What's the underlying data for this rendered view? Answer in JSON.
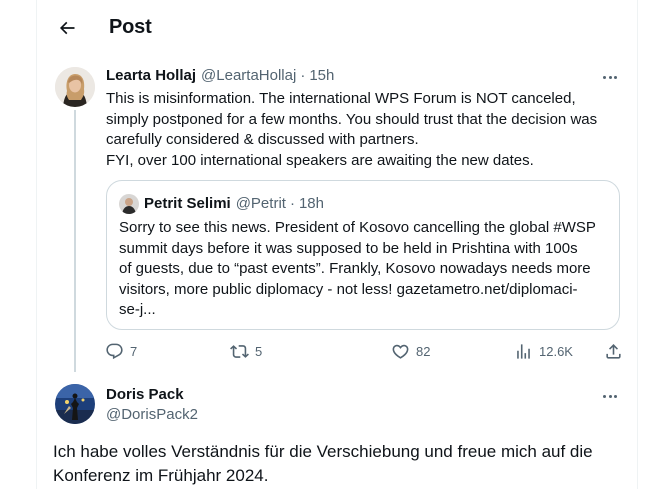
{
  "header": {
    "title": "Post"
  },
  "main_tweet": {
    "author_name": "Learta Hollaj",
    "handle": "@LeartaHollaj",
    "separator": "·",
    "time": "15h",
    "text_lines": [
      "This is misinformation. The international WPS Forum is NOT canceled,",
      "simply postponed for a few months. You should trust that the decision was",
      "carefully considered & discussed with partners.",
      "FYI, over 100 international speakers are awaiting the new dates."
    ],
    "quote": {
      "author_name": "Petrit Selimi",
      "handle": "@Petrit",
      "separator": "·",
      "time": "18h",
      "text_lines": [
        "Sorry to see this news. President of Kosovo cancelling the global #WSP",
        "summit days before it was supposed to be held in Prishtina with 100s",
        "of guests, due to “past events”. Frankly, Kosovo nowadays needs more",
        "visitors, more public diplomacy - not less! gazetametro.net/diplomaci-",
        "se-j..."
      ]
    },
    "actions": {
      "replies": "7",
      "reposts": "5",
      "likes": "82",
      "views": "12.6K"
    }
  },
  "reply_tweet": {
    "author_name": "Doris Pack",
    "handle": "@DorisPack2",
    "text_lines": [
      "Ich habe volles Verständnis für die Verschiebung und freue mich auf die",
      "Konferenz im Frühjahr 2024."
    ]
  },
  "icons": {
    "back": "arrow-left-icon",
    "more": "more-dots-icon",
    "reply": "reply-bubble-icon",
    "repost": "repost-icon",
    "like": "heart-icon",
    "views": "analytics-bars-icon",
    "share": "share-icon"
  },
  "colors": {
    "text": "#0f1419",
    "muted": "#536471",
    "border": "#cfd9de",
    "divider": "#eff3f4"
  }
}
